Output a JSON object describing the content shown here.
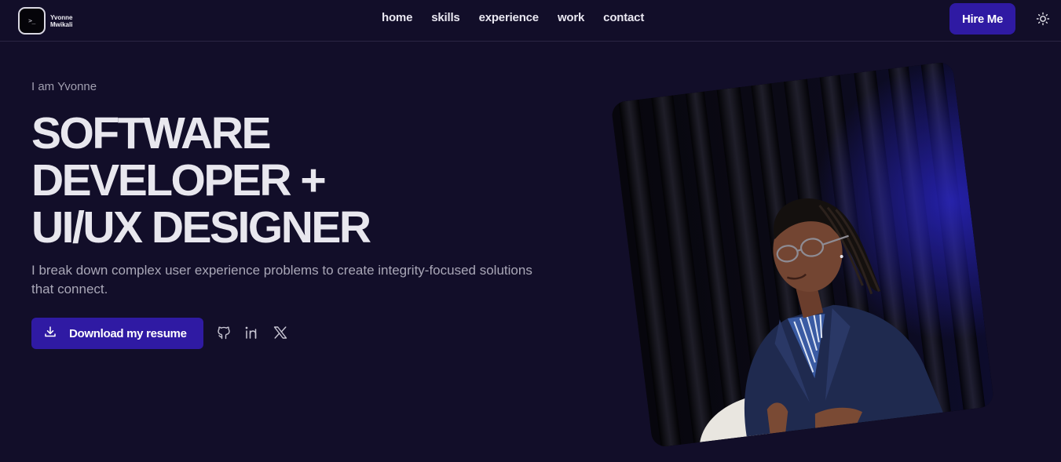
{
  "logo": {
    "mark": ">_",
    "name_line1": "Yvonne",
    "name_line2": "Mwikali"
  },
  "nav": {
    "items": [
      "home",
      "skills",
      "experience",
      "work",
      "contact"
    ],
    "hire_label": "Hire Me"
  },
  "hero": {
    "intro": "I am Yvonne",
    "title_line1": "SOFTWARE",
    "title_line2": "DEVELOPER +",
    "title_line3": "UI/UX DESIGNER",
    "description": "I break down complex user experience problems to create integrity-focused solutions that connect.",
    "download_label": "Download my resume"
  },
  "icons": {
    "theme": "sun-icon",
    "download": "download-icon",
    "github": "github-icon",
    "linkedin": "linkedin-icon",
    "x": "x-icon"
  },
  "colors": {
    "background": "#120e29",
    "accent": "#2f1aa3",
    "text": "#e8e7ee",
    "muted": "#a9a7b7"
  }
}
